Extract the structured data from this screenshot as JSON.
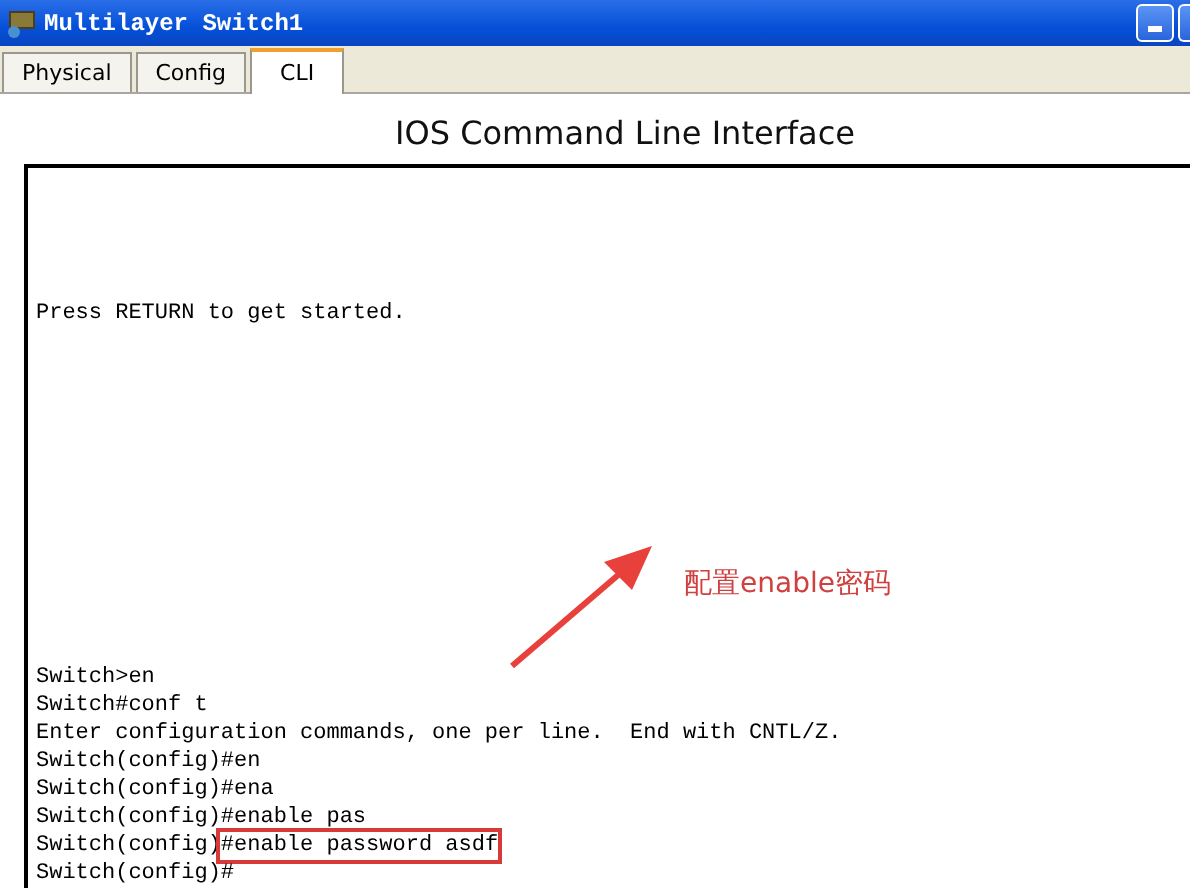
{
  "window": {
    "title": "Multilayer Switch1"
  },
  "tabs": [
    {
      "label": "Physical",
      "selected": false
    },
    {
      "label": "Config",
      "selected": false
    },
    {
      "label": "CLI",
      "selected": true
    }
  ],
  "heading": "IOS Command Line Interface",
  "terminal": {
    "intro": "Press RETURN to get started.",
    "lines": [
      {
        "text": "Switch>en"
      },
      {
        "text": "Switch#conf t"
      },
      {
        "text": "Enter configuration commands, one per line.  End with CNTL/Z."
      },
      {
        "text": "Switch(config)#en"
      },
      {
        "text": "Switch(config)#ena"
      },
      {
        "text": "Switch(config)#enable pas"
      },
      {
        "text": "Switch(config)",
        "highlight": "#enable password asdf"
      },
      {
        "text": "Switch(config)#"
      }
    ]
  },
  "annotation": {
    "label": "配置enable密码"
  }
}
